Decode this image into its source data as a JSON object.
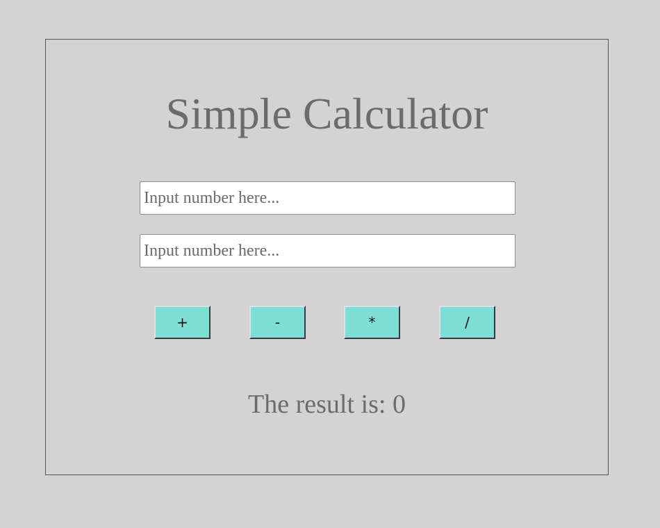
{
  "app": {
    "title": "Simple Calculator"
  },
  "inputs": [
    {
      "value": "",
      "placeholder": "Input number here..."
    },
    {
      "value": "",
      "placeholder": "Input number here..."
    }
  ],
  "operations": [
    {
      "label": "+"
    },
    {
      "label": "-"
    },
    {
      "label": "*"
    },
    {
      "label": "/"
    }
  ],
  "result": {
    "text": "The result is: 0"
  },
  "colors": {
    "background": "#d3d3d3",
    "button_fill": "#7ddfd3",
    "text": "#6b6b6b"
  }
}
